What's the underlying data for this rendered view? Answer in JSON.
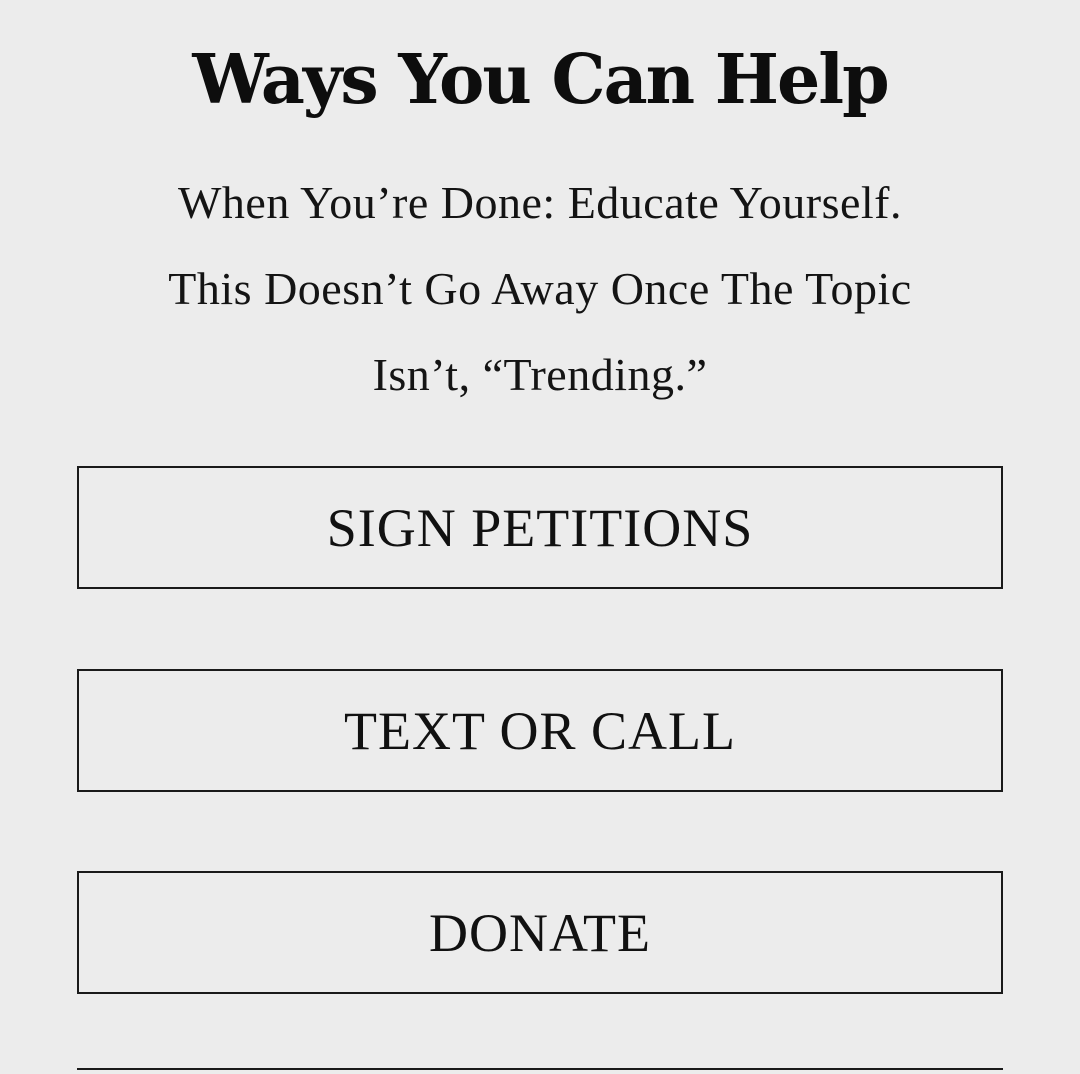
{
  "page": {
    "title": "Ways You Can Help",
    "subtitle_lines": [
      "When You’re Done: Educate Yourself.",
      "This Doesn’t Go Away Once The Topic",
      "Isn’t, “Trending.”"
    ]
  },
  "actions": [
    {
      "label": "SIGN PETITIONS"
    },
    {
      "label": "TEXT OR CALL"
    },
    {
      "label": "DONATE"
    }
  ],
  "colors": {
    "background": "#ececec",
    "text": "#111111",
    "border": "#1a1a1a"
  }
}
